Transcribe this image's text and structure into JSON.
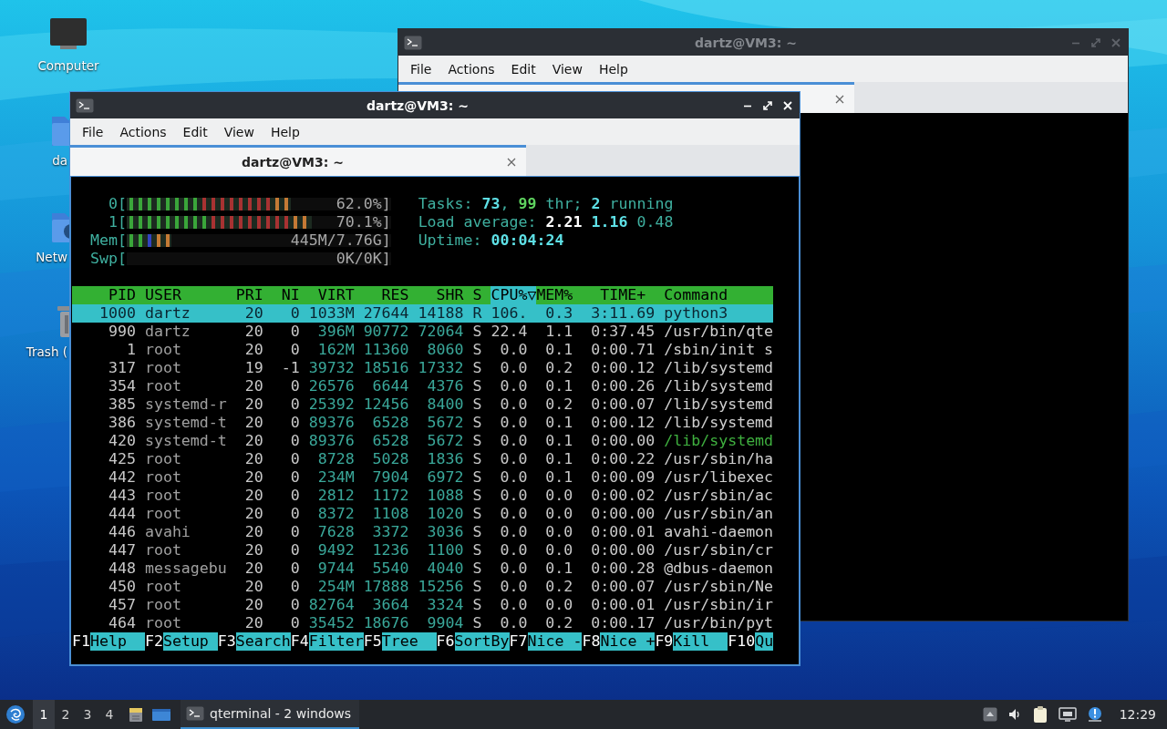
{
  "desktop": {
    "icons": [
      {
        "kind": "computer",
        "label": "Computer"
      },
      {
        "kind": "folder",
        "label": "da"
      },
      {
        "kind": "network",
        "label": "Netw"
      },
      {
        "kind": "trash",
        "label": "Trash ("
      }
    ]
  },
  "windows": [
    {
      "title": "dartz@VM3: ~",
      "active": false,
      "menu": [
        "File",
        "Actions",
        "Edit",
        "View",
        "Help"
      ],
      "tabs": [
        {
          "selected": true
        }
      ]
    },
    {
      "title": "dartz@VM3: ~",
      "active": true,
      "menu": [
        "File",
        "Actions",
        "Edit",
        "View",
        "Help"
      ],
      "tabs": [
        {
          "label": "dartz@VM3: ~",
          "selected": true
        }
      ],
      "htop": {
        "meters": [
          {
            "kind": "cpu",
            "label": "0[",
            "level": 0.62,
            "reading": "62.0%]"
          },
          {
            "kind": "cpu",
            "label": "1[",
            "level": 0.7,
            "reading": "70.1%]"
          },
          {
            "kind": "mem",
            "label": "Mem[",
            "level": 0.17,
            "reading": "445M/7.76G]"
          },
          {
            "kind": "swap",
            "label": "Swp[",
            "level": 0,
            "reading": "0K/0K]"
          }
        ],
        "summary": [
          [
            {
              "kind": "label",
              "text": "Tasks: "
            },
            {
              "kind": "value",
              "text": "73"
            },
            {
              "kind": "label",
              "text": ", "
            },
            {
              "kind": "threads",
              "text": "99"
            },
            {
              "kind": "label",
              "text": " thr; "
            },
            {
              "kind": "value",
              "text": "2"
            },
            {
              "kind": "label",
              "text": " running"
            }
          ],
          [
            {
              "kind": "label",
              "text": "Load average: "
            },
            {
              "kind": "strong",
              "text": "2.21"
            },
            {
              "kind": "value",
              "text": "1.16"
            },
            {
              "kind": "label",
              "text": " 0.48"
            }
          ],
          [
            {
              "kind": "label",
              "text": "Uptime: "
            },
            {
              "kind": "value",
              "text": "00:04:24"
            }
          ]
        ],
        "columns": [
          {
            "label": "PID",
            "selected": false
          },
          {
            "label": "USER",
            "selected": false
          },
          {
            "label": "PRI",
            "selected": false
          },
          {
            "label": "NI",
            "selected": false
          },
          {
            "label": "VIRT",
            "selected": false
          },
          {
            "label": "RES",
            "selected": false
          },
          {
            "label": "SHR",
            "selected": false
          },
          {
            "label": "S",
            "selected": false
          },
          {
            "label": "CPU%▽",
            "selected": true
          },
          {
            "label": "MEM%",
            "selected": false
          },
          {
            "label": "TIME+",
            "selected": false
          },
          {
            "label": "Command",
            "selected": false
          }
        ],
        "rows": [
          {
            "selected": true,
            "thread": false,
            "cells": [
              "1000",
              "dartz",
              "20",
              "0",
              "1033M",
              "27644",
              "14188",
              "R",
              "106.",
              "0.3",
              "3:11.69",
              "python3"
            ]
          },
          {
            "selected": false,
            "thread": false,
            "cells": [
              "990",
              "dartz",
              "20",
              "0",
              "396M",
              "90772",
              "72064",
              "S",
              "22.4",
              "1.1",
              "0:37.45",
              "/usr/bin/qte"
            ]
          },
          {
            "selected": false,
            "thread": false,
            "cells": [
              "1",
              "root",
              "20",
              "0",
              "162M",
              "11360",
              "8060",
              "S",
              "0.0",
              "0.1",
              "0:00.71",
              "/sbin/init s"
            ]
          },
          {
            "selected": false,
            "thread": false,
            "cells": [
              "317",
              "root",
              "19",
              "-1",
              "39732",
              "18516",
              "17332",
              "S",
              "0.0",
              "0.2",
              "0:00.12",
              "/lib/systemd"
            ]
          },
          {
            "selected": false,
            "thread": false,
            "cells": [
              "354",
              "root",
              "20",
              "0",
              "26576",
              "6644",
              "4376",
              "S",
              "0.0",
              "0.1",
              "0:00.26",
              "/lib/systemd"
            ]
          },
          {
            "selected": false,
            "thread": false,
            "cells": [
              "385",
              "systemd-r",
              "20",
              "0",
              "25392",
              "12456",
              "8400",
              "S",
              "0.0",
              "0.2",
              "0:00.07",
              "/lib/systemd"
            ]
          },
          {
            "selected": false,
            "thread": false,
            "cells": [
              "386",
              "systemd-t",
              "20",
              "0",
              "89376",
              "6528",
              "5672",
              "S",
              "0.0",
              "0.1",
              "0:00.12",
              "/lib/systemd"
            ]
          },
          {
            "selected": false,
            "thread": true,
            "cells": [
              "420",
              "systemd-t",
              "20",
              "0",
              "89376",
              "6528",
              "5672",
              "S",
              "0.0",
              "0.1",
              "0:00.00",
              "/lib/systemd"
            ]
          },
          {
            "selected": false,
            "thread": false,
            "cells": [
              "425",
              "root",
              "20",
              "0",
              "8728",
              "5028",
              "1836",
              "S",
              "0.0",
              "0.1",
              "0:00.22",
              "/usr/sbin/ha"
            ]
          },
          {
            "selected": false,
            "thread": false,
            "cells": [
              "442",
              "root",
              "20",
              "0",
              "234M",
              "7904",
              "6972",
              "S",
              "0.0",
              "0.1",
              "0:00.09",
              "/usr/libexec"
            ]
          },
          {
            "selected": false,
            "thread": false,
            "cells": [
              "443",
              "root",
              "20",
              "0",
              "2812",
              "1172",
              "1088",
              "S",
              "0.0",
              "0.0",
              "0:00.02",
              "/usr/sbin/ac"
            ]
          },
          {
            "selected": false,
            "thread": false,
            "cells": [
              "444",
              "root",
              "20",
              "0",
              "8372",
              "1108",
              "1020",
              "S",
              "0.0",
              "0.0",
              "0:00.00",
              "/usr/sbin/an"
            ]
          },
          {
            "selected": false,
            "thread": false,
            "cells": [
              "446",
              "avahi",
              "20",
              "0",
              "7628",
              "3372",
              "3036",
              "S",
              "0.0",
              "0.0",
              "0:00.01",
              "avahi-daemon"
            ]
          },
          {
            "selected": false,
            "thread": false,
            "cells": [
              "447",
              "root",
              "20",
              "0",
              "9492",
              "1236",
              "1100",
              "S",
              "0.0",
              "0.0",
              "0:00.00",
              "/usr/sbin/cr"
            ]
          },
          {
            "selected": false,
            "thread": false,
            "cells": [
              "448",
              "messagebu",
              "20",
              "0",
              "9744",
              "5540",
              "4040",
              "S",
              "0.0",
              "0.1",
              "0:00.28",
              "@dbus-daemon"
            ]
          },
          {
            "selected": false,
            "thread": false,
            "cells": [
              "450",
              "root",
              "20",
              "0",
              "254M",
              "17888",
              "15256",
              "S",
              "0.0",
              "0.2",
              "0:00.07",
              "/usr/sbin/Ne"
            ]
          },
          {
            "selected": false,
            "thread": false,
            "cells": [
              "457",
              "root",
              "20",
              "0",
              "82764",
              "3664",
              "3324",
              "S",
              "0.0",
              "0.0",
              "0:00.01",
              "/usr/sbin/ir"
            ]
          },
          {
            "selected": false,
            "thread": false,
            "cells": [
              "464",
              "root",
              "20",
              "0",
              "35452",
              "18676",
              "9904",
              "S",
              "0.0",
              "0.2",
              "0:00.17",
              "/usr/bin/pyt"
            ]
          }
        ],
        "function_keys": [
          {
            "key": "F1",
            "label": "Help"
          },
          {
            "key": "F2",
            "label": "Setup"
          },
          {
            "key": "F3",
            "label": "Search"
          },
          {
            "key": "F4",
            "label": "Filter"
          },
          {
            "key": "F5",
            "label": "Tree"
          },
          {
            "key": "F6",
            "label": "SortBy"
          },
          {
            "key": "F7",
            "label": "Nice -"
          },
          {
            "key": "F8",
            "label": "Nice +"
          },
          {
            "key": "F9",
            "label": "Kill"
          },
          {
            "key": "F10",
            "label": "Qu"
          }
        ]
      }
    }
  ],
  "taskbar": {
    "workspaces": [
      {
        "label": "1",
        "selected": true
      },
      {
        "label": "2",
        "selected": false
      },
      {
        "label": "3",
        "selected": false
      },
      {
        "label": "4",
        "selected": false
      }
    ],
    "tasks": [
      {
        "label": "qterminal - 2 windows",
        "selected": true
      }
    ],
    "clock": "12:29"
  }
}
